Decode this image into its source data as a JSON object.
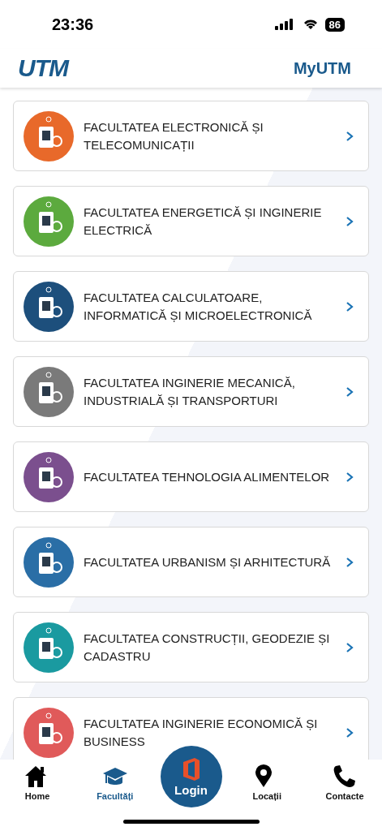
{
  "status_bar": {
    "time": "23:36",
    "battery": "86"
  },
  "header": {
    "logo": "UTM",
    "title": "MyUTM"
  },
  "faculties": [
    {
      "name": "FACULTATEA ELECTRONICĂ ȘI TELECOMUNICAȚII",
      "color": "#e8692a"
    },
    {
      "name": "FACULTATEA ENERGETICĂ ȘI INGINERIE ELECTRICĂ",
      "color": "#5caa3e"
    },
    {
      "name": "FACULTATEA CALCULATOARE, INFORMATICĂ ȘI MICROELECTRONICĂ",
      "color": "#1d4f7c"
    },
    {
      "name": "FACULTATEA INGINERIE MECANICĂ, INDUSTRIALĂ ȘI TRANSPORTURI",
      "color": "#7a7a7a"
    },
    {
      "name": "FACULTATEA TEHNOLOGIA ALIMENTELOR",
      "color": "#7b4f8e"
    },
    {
      "name": "FACULTATEA URBANISM ȘI ARHITECTURĂ",
      "color": "#2a6ea6"
    },
    {
      "name": "FACULTATEA CONSTRUCȚII, GEODEZIE ȘI CADASTRU",
      "color": "#1a9aa0"
    },
    {
      "name": "FACULTATEA INGINERIE ECONOMICĂ ȘI BUSINESS",
      "color": "#e05a5a"
    }
  ],
  "nav": [
    {
      "kind": "home",
      "label": "Home",
      "selected": false
    },
    {
      "kind": "faculties",
      "label": "Facultăți",
      "selected": true
    },
    {
      "kind": "login",
      "label": "Login",
      "selected": false
    },
    {
      "kind": "location",
      "label": "Locații",
      "selected": false
    },
    {
      "kind": "phone",
      "label": "Contacte",
      "selected": false
    }
  ]
}
